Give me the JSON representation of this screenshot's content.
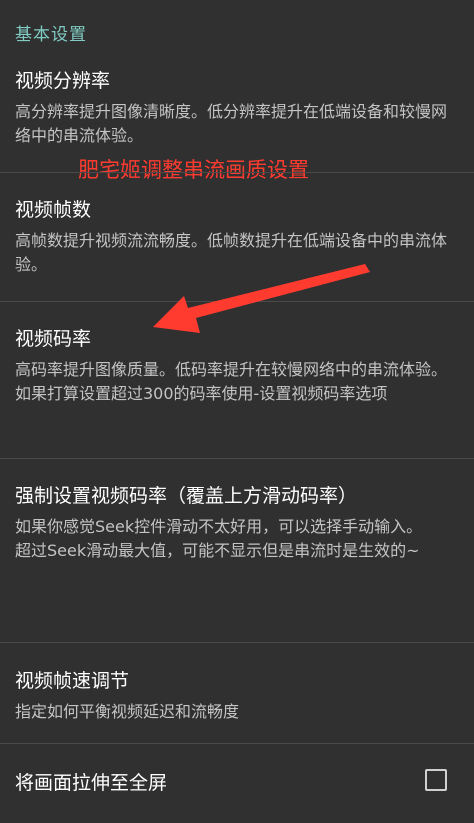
{
  "category": {
    "label": "基本设置",
    "color": "#80cbc4"
  },
  "overlay": {
    "annotation": "肥宅姬调整串流画质设置",
    "color": "#ff3b30"
  },
  "prefs": [
    {
      "title": "视频分辨率",
      "summary": "高分辨率提升图像清晰度。低分辨率提升在低端设备和较慢网络中的串流体验。"
    },
    {
      "title": "视频帧数",
      "summary": "高帧数提升视频流流畅度。低帧数提升在低端设备中的串流体验。"
    },
    {
      "title": "视频码率",
      "summary": "高码率提升图像质量。低码率提升在较慢网络中的串流体验。",
      "summary2": "如果打算设置超过300的码率使用-设置视频码率选项"
    },
    {
      "title": "强制设置视频码率（覆盖上方滑动码率）",
      "summary": "如果你感觉Seek控件滑动不太好用，可以选择手动输入。",
      "summary2": "超过Seek滑动最大值，可能不显示但是串流时是生效的~"
    },
    {
      "title": "视频帧速调节",
      "summary": "指定如何平衡视频延迟和流畅度"
    },
    {
      "title": "将画面拉伸至全屏",
      "checked": false
    }
  ]
}
